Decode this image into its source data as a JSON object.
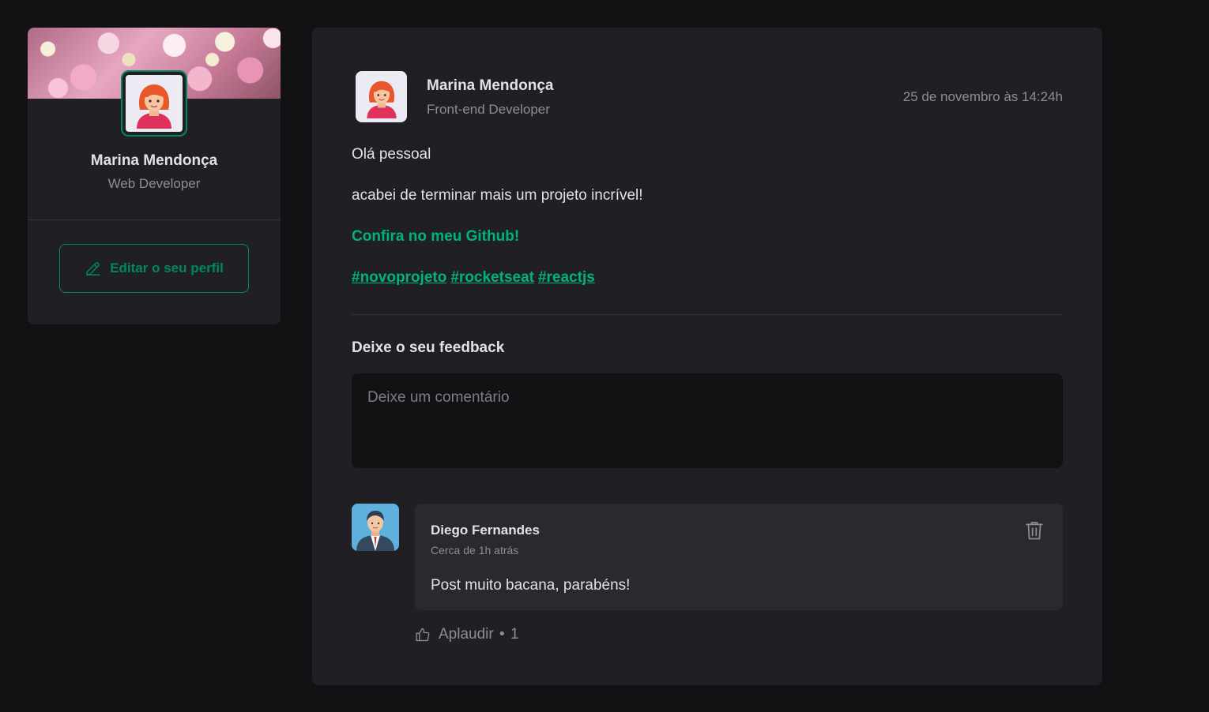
{
  "sidebar": {
    "name": "Marina Mendonça",
    "role": "Web Developer",
    "edit_button_label": "Editar o seu perfil"
  },
  "post": {
    "author_name": "Marina Mendonça",
    "author_role": "Front-end Developer",
    "published_at": "25 de novembro às 14:24h",
    "paragraphs": [
      "Olá pessoal",
      "acabei de terminar mais um projeto incrível!"
    ],
    "link_text": "Confira no meu Github!",
    "hashtags": [
      "#novoprojeto",
      "#rocketseat",
      "#reactjs"
    ]
  },
  "feedback": {
    "title": "Deixe o seu feedback",
    "placeholder": "Deixe um comentário"
  },
  "comment": {
    "author": "Diego Fernandes",
    "time": "Cerca de 1h atrás",
    "text": "Post muito bacana, parabéns!",
    "applaud_label": "Aplaudir",
    "applaud_separator": "•",
    "applaud_count": "1"
  },
  "colors": {
    "background": "#121214",
    "panel": "#202024",
    "comment_panel": "#29292e",
    "accent": "#00875f",
    "accent_light": "#00b37e"
  },
  "icons": {
    "edit": "pencil-icon",
    "delete": "trash-icon",
    "applaud": "thumbs-up-icon"
  }
}
